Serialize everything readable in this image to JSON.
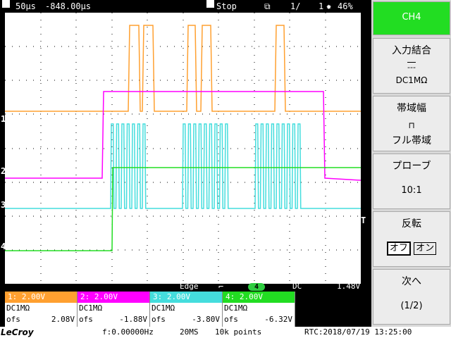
{
  "topbar": {
    "timebase": "50µs",
    "delay": "-848.00µs",
    "run_state": "Stop",
    "page": "1/",
    "page_total": "1",
    "brightness": "46%"
  },
  "channels": [
    {
      "id": "1",
      "marker": "1",
      "color": "#ffa030",
      "volts": "1: 2.00V",
      "coupling": "DC1MΩ",
      "ofs_label": "ofs",
      "ofs": "2.08V"
    },
    {
      "id": "2",
      "marker": "2",
      "color": "#ff00ff",
      "volts": "2: 2.00V",
      "coupling": "DC1MΩ",
      "ofs_label": "ofs",
      "ofs": "-1.88V"
    },
    {
      "id": "3",
      "marker": "3",
      "color": "#44dddd",
      "volts": "3: 2.00V",
      "coupling": "DC1MΩ",
      "ofs_label": "ofs",
      "ofs": "-3.80V"
    },
    {
      "id": "4",
      "marker": "4",
      "color": "#22dd22",
      "volts": "4: 2.00V",
      "coupling": "DC1MΩ",
      "ofs_label": "ofs",
      "ofs": "-6.32V"
    }
  ],
  "trigger": {
    "mode": "Edge",
    "source": "4",
    "coupling": "DC",
    "level": "1.48V",
    "marker": "T"
  },
  "status": {
    "brand": "LeCroy",
    "freq": "f:0.00000Hz",
    "sample_rate": "20MS",
    "points": "10k points",
    "rtc": "RTC:2018/07/19 13:25:00"
  },
  "side_menu": {
    "channel": "CH4",
    "coupling_title": "入力結合",
    "coupling_symbol": "---",
    "coupling_value": "DC1MΩ",
    "bandwidth_title": "帯域幅",
    "bandwidth_value": "フル帯域",
    "probe_title": "プローブ",
    "probe_value": "10:1",
    "invert_title": "反転",
    "invert_off": "オフ",
    "invert_on": "オン",
    "next_title": "次へ",
    "next_page": "(1/2)"
  },
  "colors": {
    "ch1": "#ffa030",
    "ch2": "#ff00ff",
    "ch3": "#44dddd",
    "ch4": "#22dd22",
    "menu_active": "#22dd22"
  }
}
